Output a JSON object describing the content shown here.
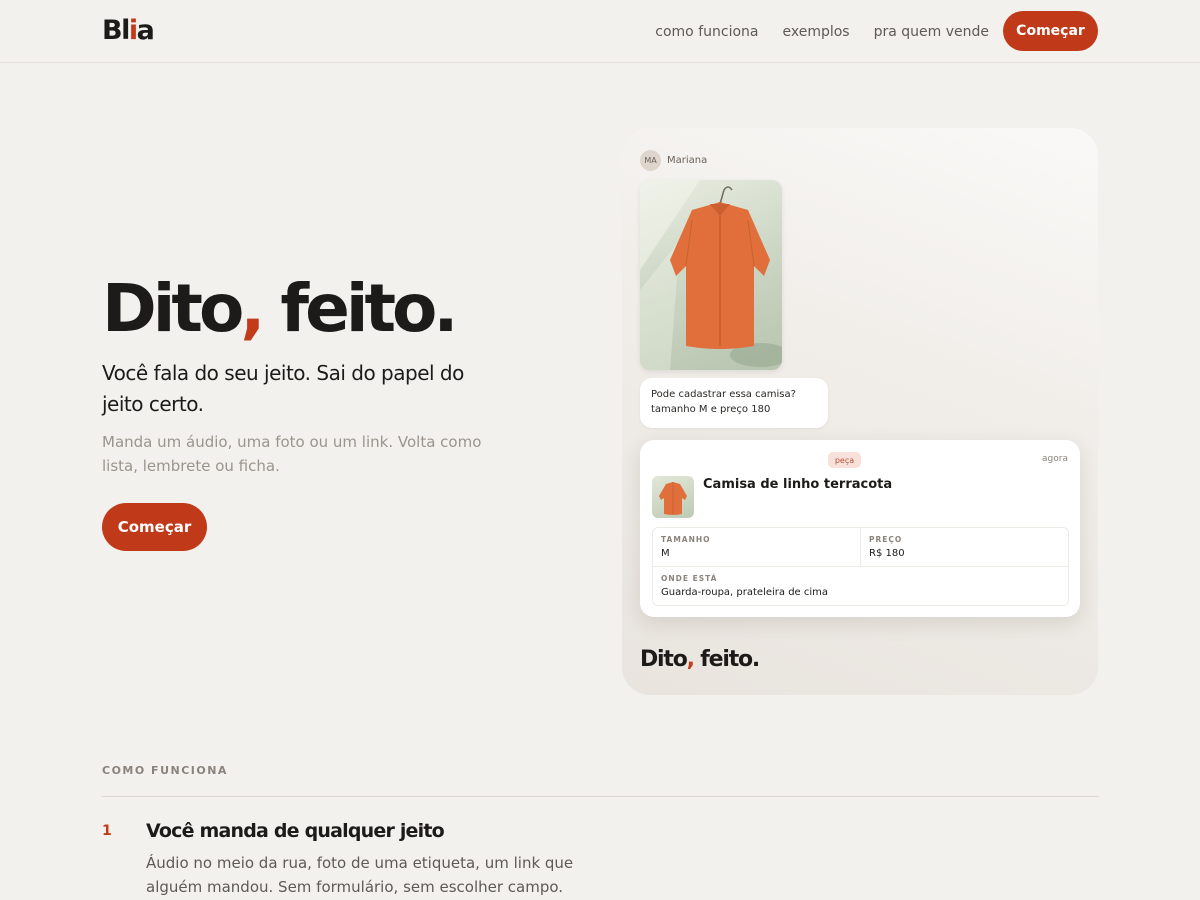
{
  "nav": {
    "logo_main": "Bl",
    "logo_accent": "i",
    "logo_end": "a",
    "links": [
      "como funciona",
      "exemplos",
      "pra quem vende"
    ],
    "cta": "Começar"
  },
  "hero": {
    "title_part1": "Dito",
    "title_comma": ",",
    "title_part2": " feito.",
    "subtitle": "Você fala do seu jeito. Sai do papel do jeito certo.",
    "description": "Manda um áudio, uma foto ou um link. Volta como lista, lembrete ou ficha.",
    "cta": "Começar"
  },
  "card": {
    "sender_initials": "MA",
    "sender_name": "Mariana",
    "message_line1": "Pode cadastrar essa camisa?",
    "message_line2": "tamanho M e preço 180",
    "result": {
      "tag": "peça",
      "time": "agora",
      "item_title": "Camisa de linho terracota",
      "fields": [
        {
          "label": "TAMANHO",
          "value": "M"
        },
        {
          "label": "PREÇO",
          "value": "R$ 180"
        },
        {
          "label": "ONDE ESTÁ",
          "value": "Guarda-roupa, prateleira de cima"
        }
      ]
    },
    "tagline_part1": "Dito",
    "tagline_comma": ",",
    "tagline_part2": " feito."
  },
  "how_it_works": {
    "eyebrow": "COMO FUNCIONA",
    "steps": [
      {
        "number": "1",
        "title": "Você manda de qualquer jeito",
        "description": "Áudio no meio da rua, foto de uma etiqueta, um link que alguém mandou. Sem formulário, sem escolher campo."
      }
    ]
  },
  "colors": {
    "background": "#f3f1ed",
    "accent": "#c03a1a",
    "text": "#1d1b19",
    "muted": "#9a948c"
  },
  "icons": {
    "product_image": "orange-linen-shirt-photo"
  }
}
